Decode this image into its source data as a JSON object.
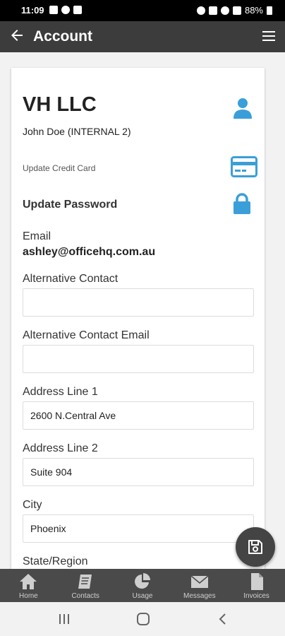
{
  "status_bar": {
    "time": "11:09",
    "battery": "88%"
  },
  "app_bar": {
    "title": "Account",
    "back_icon": "arrow-left-icon",
    "menu_icon": "hamburger-menu-icon"
  },
  "account": {
    "company": "VH LLC",
    "contact": "John Doe (INTERNAL 2)",
    "update_credit_card": "Update Credit Card",
    "update_password": "Update Password",
    "email_label": "Email",
    "email_value": "ashley@officehq.com.au"
  },
  "form": {
    "alt_contact_label": "Alternative Contact",
    "alt_contact_value": "",
    "alt_contact_email_label": "Alternative Contact Email",
    "alt_contact_email_value": "",
    "address1_label": "Address Line 1",
    "address1_value": "2600 N.Central Ave",
    "address2_label": "Address Line 2",
    "address2_value": "Suite 904",
    "city_label": "City",
    "city_value": "Phoenix",
    "state_label": "State/Region"
  },
  "tabs": [
    {
      "label": "Home",
      "icon": "home-icon"
    },
    {
      "label": "Contacts",
      "icon": "contacts-book-icon"
    },
    {
      "label": "Usage",
      "icon": "pie-chart-icon"
    },
    {
      "label": "Messages",
      "icon": "envelope-icon"
    },
    {
      "label": "Invoices",
      "icon": "document-icon"
    }
  ],
  "colors": {
    "accent": "#3a9fd8",
    "app_bar": "#3c3c3c",
    "tab_bar": "#4a4a4a"
  }
}
